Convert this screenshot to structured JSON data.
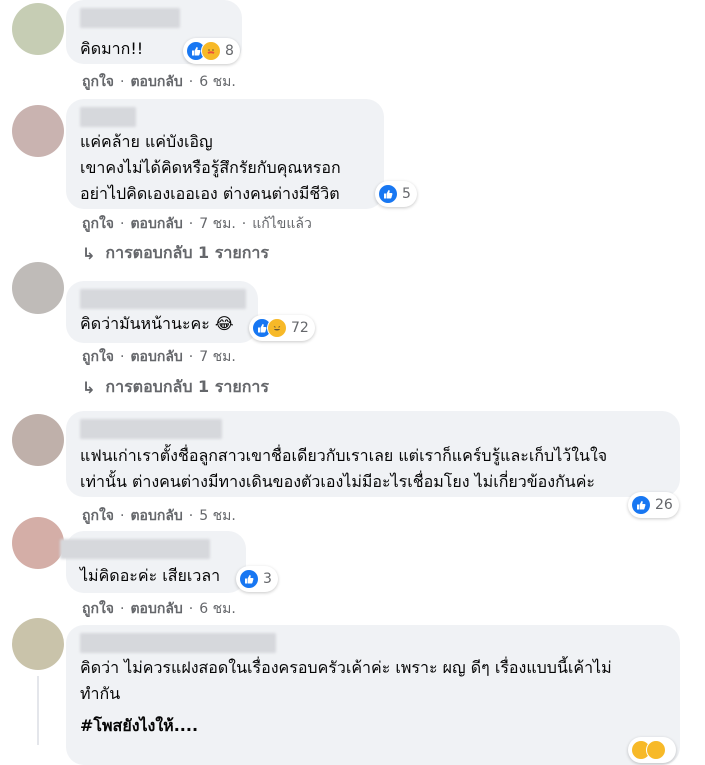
{
  "reactions": {
    "like_color": "#1877f2",
    "haha_color": "#f7b928"
  },
  "comments": [
    {
      "text": "คิดมาก!!",
      "reaction_count": "8",
      "actions": {
        "like": "ถูกใจ",
        "reply": "ตอบกลับ",
        "time": "6 ชม."
      }
    },
    {
      "text": "แค่คล้าย แค่บังเอิญ\nเขาคงไม่ได้คิดหรือรู้สึกรัยกับคุณหรอก\nอย่าไปคิดเองเออเอง ต่างคนต่างมีชีวิต",
      "reaction_count": "5",
      "actions": {
        "like": "ถูกใจ",
        "reply": "ตอบกลับ",
        "time": "7 ชม.",
        "edited": "แก้ไขแล้ว"
      },
      "replies_label": "การตอบกลับ 1 รายการ"
    },
    {
      "text": "คิดว่ามันหน้านะคะ 😂",
      "reaction_count": "72",
      "actions": {
        "like": "ถูกใจ",
        "reply": "ตอบกลับ",
        "time": "7 ชม."
      },
      "replies_label": "การตอบกลับ 1 รายการ"
    },
    {
      "text": "แฟนเก่าเราตั้งชื่อลูกสาวเขาชื่อเดียวกับเราเลย แต่เราก็แคร์บรู้และเก็บไว้ในใจ\nเท่านั้น ต่างคนต่างมีทางเดินของตัวเองไม่มีอะไรเชื่อมโยง ไม่เกี่ยวข้องกันค่ะ",
      "reaction_count": "26",
      "actions": {
        "like": "ถูกใจ",
        "reply": "ตอบกลับ",
        "time": "5 ชม."
      }
    },
    {
      "text": "ไม่คิดอะค่ะ เสียเวลา",
      "reaction_count": "3",
      "actions": {
        "like": "ถูกใจ",
        "reply": "ตอบกลับ",
        "time": "6 ชม."
      }
    },
    {
      "text": "คิดว่า ไม่ควรแฝงสอดในเรื่องครอบครัวเค้าค่ะ เพราะ ผญ ดีๆ เรื่องแบบนี้เค้าไม่\nทำกัน",
      "hashtag": "#โพสยังไงให้....",
      "reaction_count": ""
    }
  ]
}
